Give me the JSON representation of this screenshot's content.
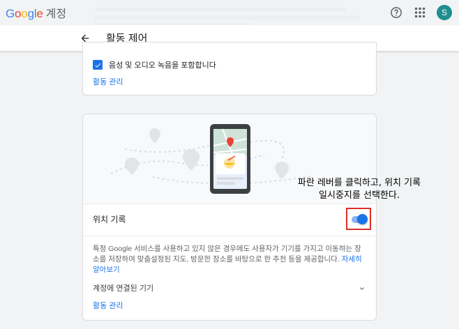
{
  "header": {
    "brand": "Google",
    "product": "계정",
    "avatar_letter": "S",
    "icons": [
      "help-icon",
      "apps-grid-icon"
    ]
  },
  "subheader": {
    "title": "활동 제어"
  },
  "card_audio": {
    "checkbox_label": "음성 및 오디오 녹음을 포함합니다",
    "checkbox_checked": true,
    "manage_link": "활동 관리"
  },
  "card_location": {
    "title": "위치 기록",
    "toggle_on": true,
    "description": "특정 Google 서비스를 사용하고 있지 않은 경우에도 사용자가 기기를 가지고 이동하는 장소를 저장하여 맞춤설정된 지도, 방문한 장소를 바탕으로 한 추천 등을 제공합니다.",
    "learn_more": "자세히 알아보기",
    "devices_label": "계정에 연결된 기기",
    "manage_link": "활동 관리"
  },
  "annotation": {
    "line1": "파란 레버를 클릭하고, 위치 기록",
    "line2": "일시중지를 선택한다."
  },
  "colors": {
    "accent": "#1a73e8",
    "highlight_box": "#d93025",
    "avatar_bg": "#1e8e8e"
  }
}
